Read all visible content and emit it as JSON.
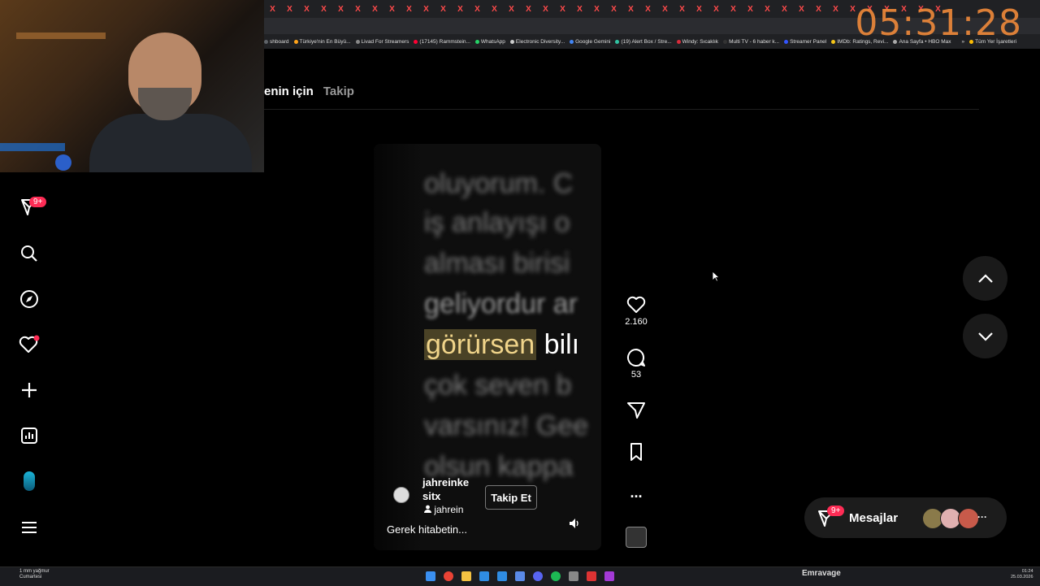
{
  "browser": {
    "tab_close_glyph": "X",
    "tab_count": 40,
    "bookmarks": [
      {
        "label": "shboard",
        "color": "#5f6368"
      },
      {
        "label": "Türkiye'nin En Büyü...",
        "color": "#ffa31a"
      },
      {
        "label": "Livad For Streamers",
        "color": "#888888"
      },
      {
        "label": "(17145) Rammstein...",
        "color": "#ff0033"
      },
      {
        "label": "WhatsApp",
        "color": "#25d366"
      },
      {
        "label": "Electronic Diversity...",
        "color": "#cccccc"
      },
      {
        "label": "Google Gemini",
        "color": "#4285f4"
      },
      {
        "label": "(19) Alert Box / Stre...",
        "color": "#31c3a2"
      },
      {
        "label": "Windy: Sıcaklık",
        "color": "#d92b3a"
      },
      {
        "label": "Multi TV - 6 haber k...",
        "color": "#333333"
      },
      {
        "label": "Streamer Panel",
        "color": "#3355ff"
      },
      {
        "label": "IMDb: Ratings, Revi...",
        "color": "#f5c518"
      },
      {
        "label": "Ana Sayfa • HBO Max",
        "color": "#aaaaaa"
      },
      {
        "label": "»",
        "color": "#202124"
      },
      {
        "label": "Tüm Yer İşaretleri",
        "color": "#fbbc04"
      }
    ]
  },
  "stream_overlay": {
    "clock": "05:31:28"
  },
  "header": {
    "tab_for_you": "enin için",
    "tab_following": "Takip"
  },
  "sidebar": {
    "inbox_badge": "9+",
    "items": [
      {
        "icon": "send-icon"
      },
      {
        "icon": "search-icon"
      },
      {
        "icon": "explore-icon"
      },
      {
        "icon": "activity-heart-icon"
      },
      {
        "icon": "upload-plus-icon"
      },
      {
        "icon": "analytics-icon"
      },
      {
        "icon": "profile-avatar"
      },
      {
        "icon": "menu-icon"
      }
    ]
  },
  "video": {
    "text_lines": [
      "oluyorum. C",
      "iş anlayışı o",
      "alması birisi",
      "geliyordur ar"
    ],
    "highlight_word": "görürsen",
    "after_highlight": "bilı",
    "text_lines_after": [
      "çok seven b",
      "varsınız! Gee",
      "olsun kappa"
    ],
    "author_name": "jahreinke sitx",
    "author_handle": "jahrein",
    "follow_label": "Takip Et",
    "caption": "Gerek hitabetin..."
  },
  "actions": {
    "likes": "2.160",
    "comments": "53",
    "more": "..."
  },
  "messages": {
    "badge": "9+",
    "label": "Mesajlar",
    "more": "···"
  },
  "taskbar": {
    "weather_line1": "1 mm yağmur",
    "weather_line2": "Cumartesi",
    "user": "Emravage",
    "time": "01:24",
    "date": "25.03.2026"
  },
  "colors": {
    "accent_red": "#fe2c55",
    "clock_orange": "#f08a3a",
    "highlight_bg": "#4a4226"
  }
}
